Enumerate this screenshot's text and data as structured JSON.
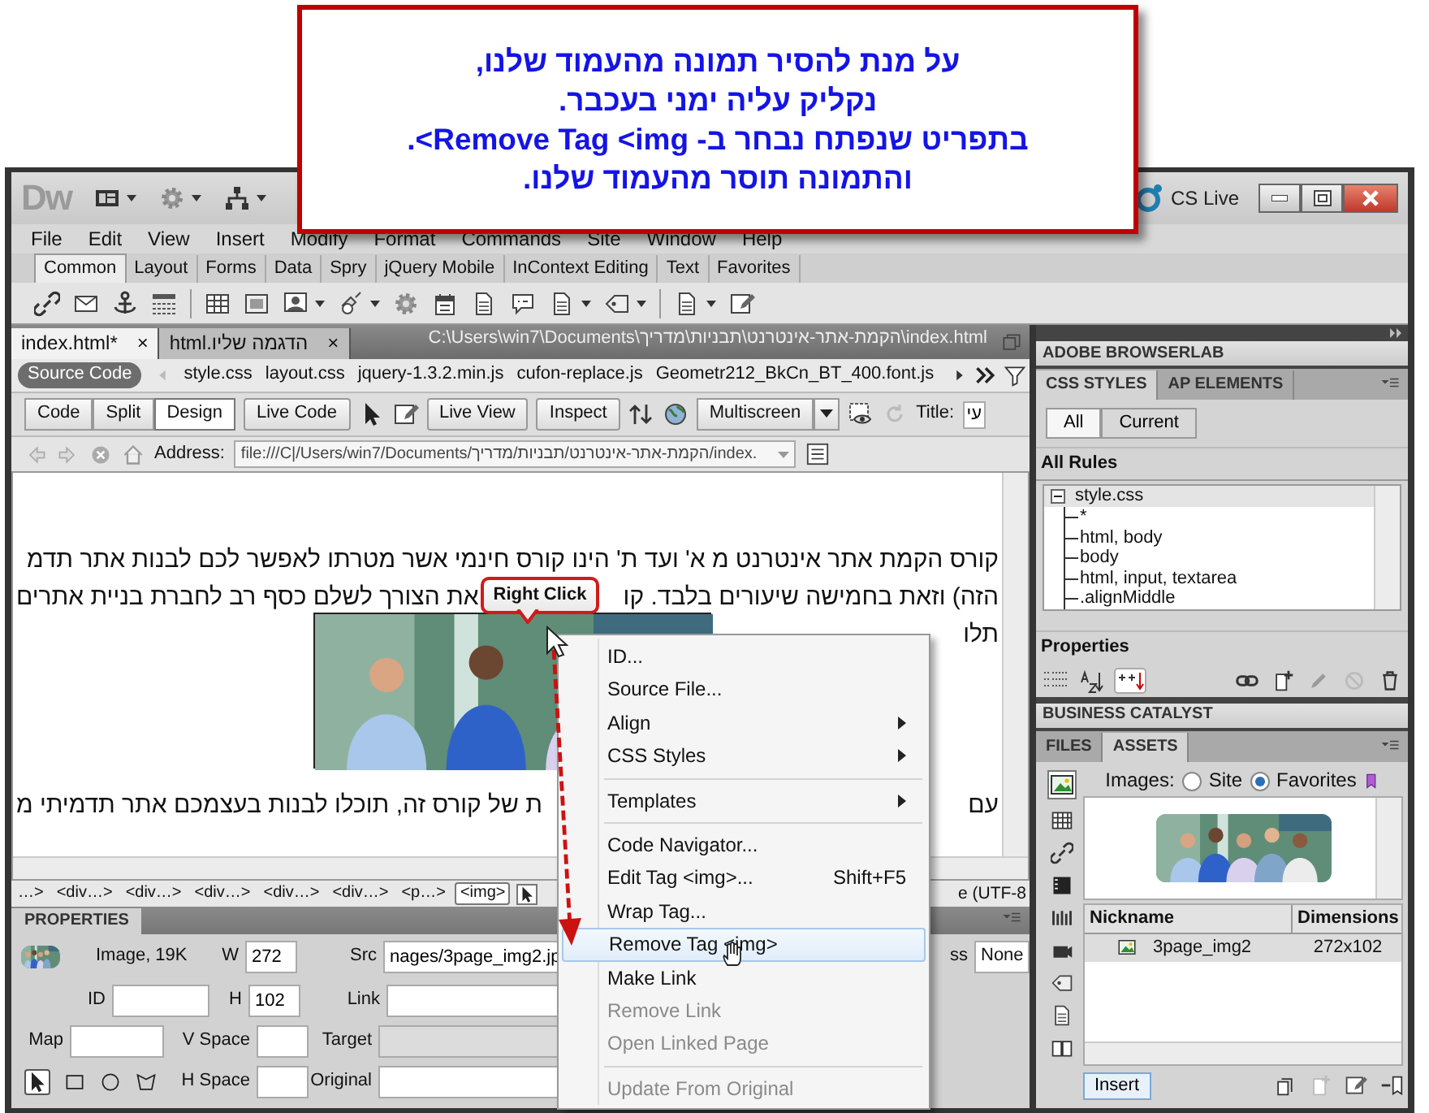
{
  "callout": {
    "lines": [
      "על מנת להסיר תמונה מהעמוד שלנו,",
      "נקליק עליה ימני בעכבר.",
      "בתפריט שנפתח נבחר ב- Remove Tag <img>.",
      "והתמונה תוסר מהעמוד שלנו."
    ]
  },
  "title_bar": {
    "logo": "Dw",
    "cs_live": "CS Live"
  },
  "menu_bar": [
    "File",
    "Edit",
    "View",
    "Insert",
    "Modify",
    "Format",
    "Commands",
    "Site",
    "Window",
    "Help"
  ],
  "insert_tabs": [
    {
      "label": "Common",
      "selected": true
    },
    {
      "label": "Layout",
      "selected": false
    },
    {
      "label": "Forms",
      "selected": false
    },
    {
      "label": "Data",
      "selected": false
    },
    {
      "label": "Spry",
      "selected": false
    },
    {
      "label": "jQuery Mobile",
      "selected": false
    },
    {
      "label": "InContext Editing",
      "selected": false
    },
    {
      "label": "Text",
      "selected": false
    },
    {
      "label": "Favorites",
      "selected": false
    }
  ],
  "document_tabs": [
    {
      "label": "index.html*",
      "selected": true,
      "close": "×"
    },
    {
      "label": "הדגמה שליו.html",
      "selected": false,
      "close": "×"
    }
  ],
  "document_path": "C:\\Users\\win7\\Documents\\הקמת-אתר-אינטרנט\\תבניות\\מדריך\\index.html",
  "related_files": {
    "source": "Source Code",
    "files": [
      "style.css",
      "layout.css",
      "jquery-1.3.2.min.js",
      "cufon-replace.js",
      "Geometr212_BkCn_BT_400.font.js"
    ]
  },
  "document_toolbar": {
    "views": [
      {
        "label": "Code",
        "selected": false
      },
      {
        "label": "Split",
        "selected": false
      },
      {
        "label": "Design",
        "selected": true
      }
    ],
    "live_code": "Live Code",
    "live_view": "Live View",
    "inspect": "Inspect",
    "multiscreen": "Multiscreen",
    "title_label": "Title:",
    "title_value": "עי"
  },
  "address_bar": {
    "label": "Address:",
    "value": "file:///C|/Users/win7/Documents/הקמת-אתר-אינטרנט/תבניות/מדריך/index."
  },
  "content": {
    "paragraphs": [
      [
        [
          "קורס הקמת אתר אינטרנט מ א' ועד ת' הינו קורס חינמי אשר מטרתו לאפשר לכם לבנות אתר תדמ"
        ],
        [
          "הזה) וזאת בחמישה שיעורים בלבד. קו",
          "את הצורך לשלם כסף רב לחברת בניית אתרים"
        ],
        [
          "תלו"
        ]
      ],
      [
        [
          "עם",
          "ת של קורס זה, תוכלו לבנות בעצמכם אתר תדמיתי מ"
        ]
      ]
    ]
  },
  "tooltip": "Right Click",
  "context_menu": [
    {
      "kind": "item",
      "label": "ID...",
      "selected": false,
      "disabled": false
    },
    {
      "kind": "item",
      "label": "Source File...",
      "selected": false,
      "disabled": false
    },
    {
      "kind": "submenu",
      "label": "Align",
      "selected": false,
      "disabled": false
    },
    {
      "kind": "submenu",
      "label": "CSS Styles",
      "selected": false,
      "disabled": false
    },
    {
      "kind": "separator"
    },
    {
      "kind": "submenu",
      "label": "Templates",
      "selected": false,
      "disabled": false
    },
    {
      "kind": "separator"
    },
    {
      "kind": "item",
      "label": "Code Navigator...",
      "selected": false,
      "disabled": false
    },
    {
      "kind": "item",
      "label": "Edit Tag <img>...",
      "shortcut": "Shift+F5",
      "selected": false,
      "disabled": false
    },
    {
      "kind": "item",
      "label": "Wrap Tag...",
      "selected": false,
      "disabled": false
    },
    {
      "kind": "item",
      "label": "Remove Tag <img>",
      "selected": true,
      "disabled": false
    },
    {
      "kind": "item",
      "label": "Make Link",
      "selected": false,
      "disabled": false
    },
    {
      "kind": "item",
      "label": "Remove Link",
      "selected": false,
      "disabled": true
    },
    {
      "kind": "item",
      "label": "Open Linked Page",
      "selected": false,
      "disabled": true
    },
    {
      "kind": "separator"
    },
    {
      "kind": "item",
      "label": "Update From Original",
      "selected": false,
      "disabled": true
    }
  ],
  "tag_selector": {
    "tags": [
      {
        "label": "…>",
        "selected": false
      },
      {
        "label": "<div…>",
        "selected": false
      },
      {
        "label": "<div…>",
        "selected": false
      },
      {
        "label": "<div…>",
        "selected": false
      },
      {
        "label": "<div…>",
        "selected": false
      },
      {
        "label": "<div…>",
        "selected": false
      },
      {
        "label": "<p…>",
        "selected": false
      },
      {
        "label": "<img>",
        "selected": true
      }
    ],
    "encoding": "e (UTF-8"
  },
  "properties": {
    "tab": "PROPERTIES",
    "summary": "Image, 19K",
    "fields": [
      {
        "label": "W",
        "value": "272",
        "disabled": false
      },
      {
        "label": "Src",
        "value": "nages/3page_img2.jp",
        "disabled": false
      },
      {
        "label": "ID",
        "disabled": false
      },
      {
        "label": "H",
        "value": "102",
        "disabled": false
      },
      {
        "label": "Link",
        "disabled": false
      },
      {
        "label": "Map",
        "disabled": false
      },
      {
        "label": "V Space",
        "disabled": false
      },
      {
        "label": "Target",
        "disabled": true
      },
      {
        "label": "H Space",
        "disabled": false
      },
      {
        "label": "Original",
        "disabled": false
      }
    ],
    "class_label": "ss",
    "class_value": "None"
  },
  "panels": {
    "browserlab": "ADOBE BROWSERLAB",
    "css_tabs": [
      {
        "label": "CSS STYLES",
        "selected": true
      },
      {
        "label": "AP ELEMENTS",
        "selected": false
      }
    ],
    "modes": [
      {
        "label": "All",
        "selected": true
      },
      {
        "label": "Current",
        "selected": false
      }
    ],
    "rules_title": "All Rules",
    "tree": {
      "label": "style.css",
      "expanded": true,
      "children": [
        {
          "label": "*"
        },
        {
          "label": "html, body"
        },
        {
          "label": "body"
        },
        {
          "label": "html, input, textarea"
        },
        {
          "label": ".alignMiddle"
        }
      ]
    },
    "properties_title": "Properties",
    "business_catalyst": "BUSINESS CATALYST",
    "files_tabs": [
      {
        "label": "FILES",
        "selected": false
      },
      {
        "label": "ASSETS",
        "selected": true
      }
    ],
    "images_label": "Images:",
    "image_options": [
      {
        "label": "Site",
        "selected": false
      },
      {
        "label": "Favorites",
        "selected": true
      }
    ],
    "columns": [
      "Nickname",
      "Dimensions"
    ],
    "rows": [
      [
        "3page_img2",
        "272x102"
      ]
    ],
    "insert": "Insert"
  }
}
